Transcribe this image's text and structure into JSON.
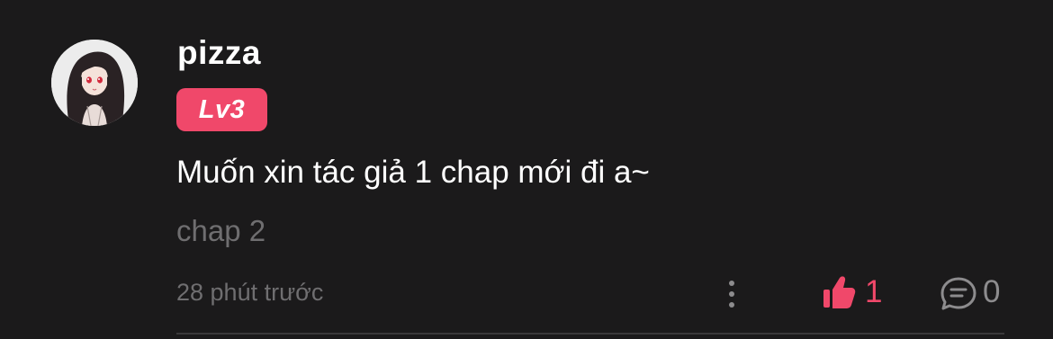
{
  "comment": {
    "username": "pizza",
    "level_badge": "Lv3",
    "text": "Muốn xin tác giả 1 chap mới đi a~",
    "chapter": "chap 2",
    "timestamp": "28 phút trước"
  },
  "actions": {
    "more_icon": "more-vertical-icon",
    "like_icon": "thumbs-up-icon",
    "like_count": "1",
    "reply_icon": "speech-bubble-icon",
    "reply_count": "0"
  },
  "colors": {
    "background": "#1b1a1b",
    "accent": "#f0486a",
    "muted_text": "#6f6e70",
    "primary_text": "#ffffff"
  }
}
